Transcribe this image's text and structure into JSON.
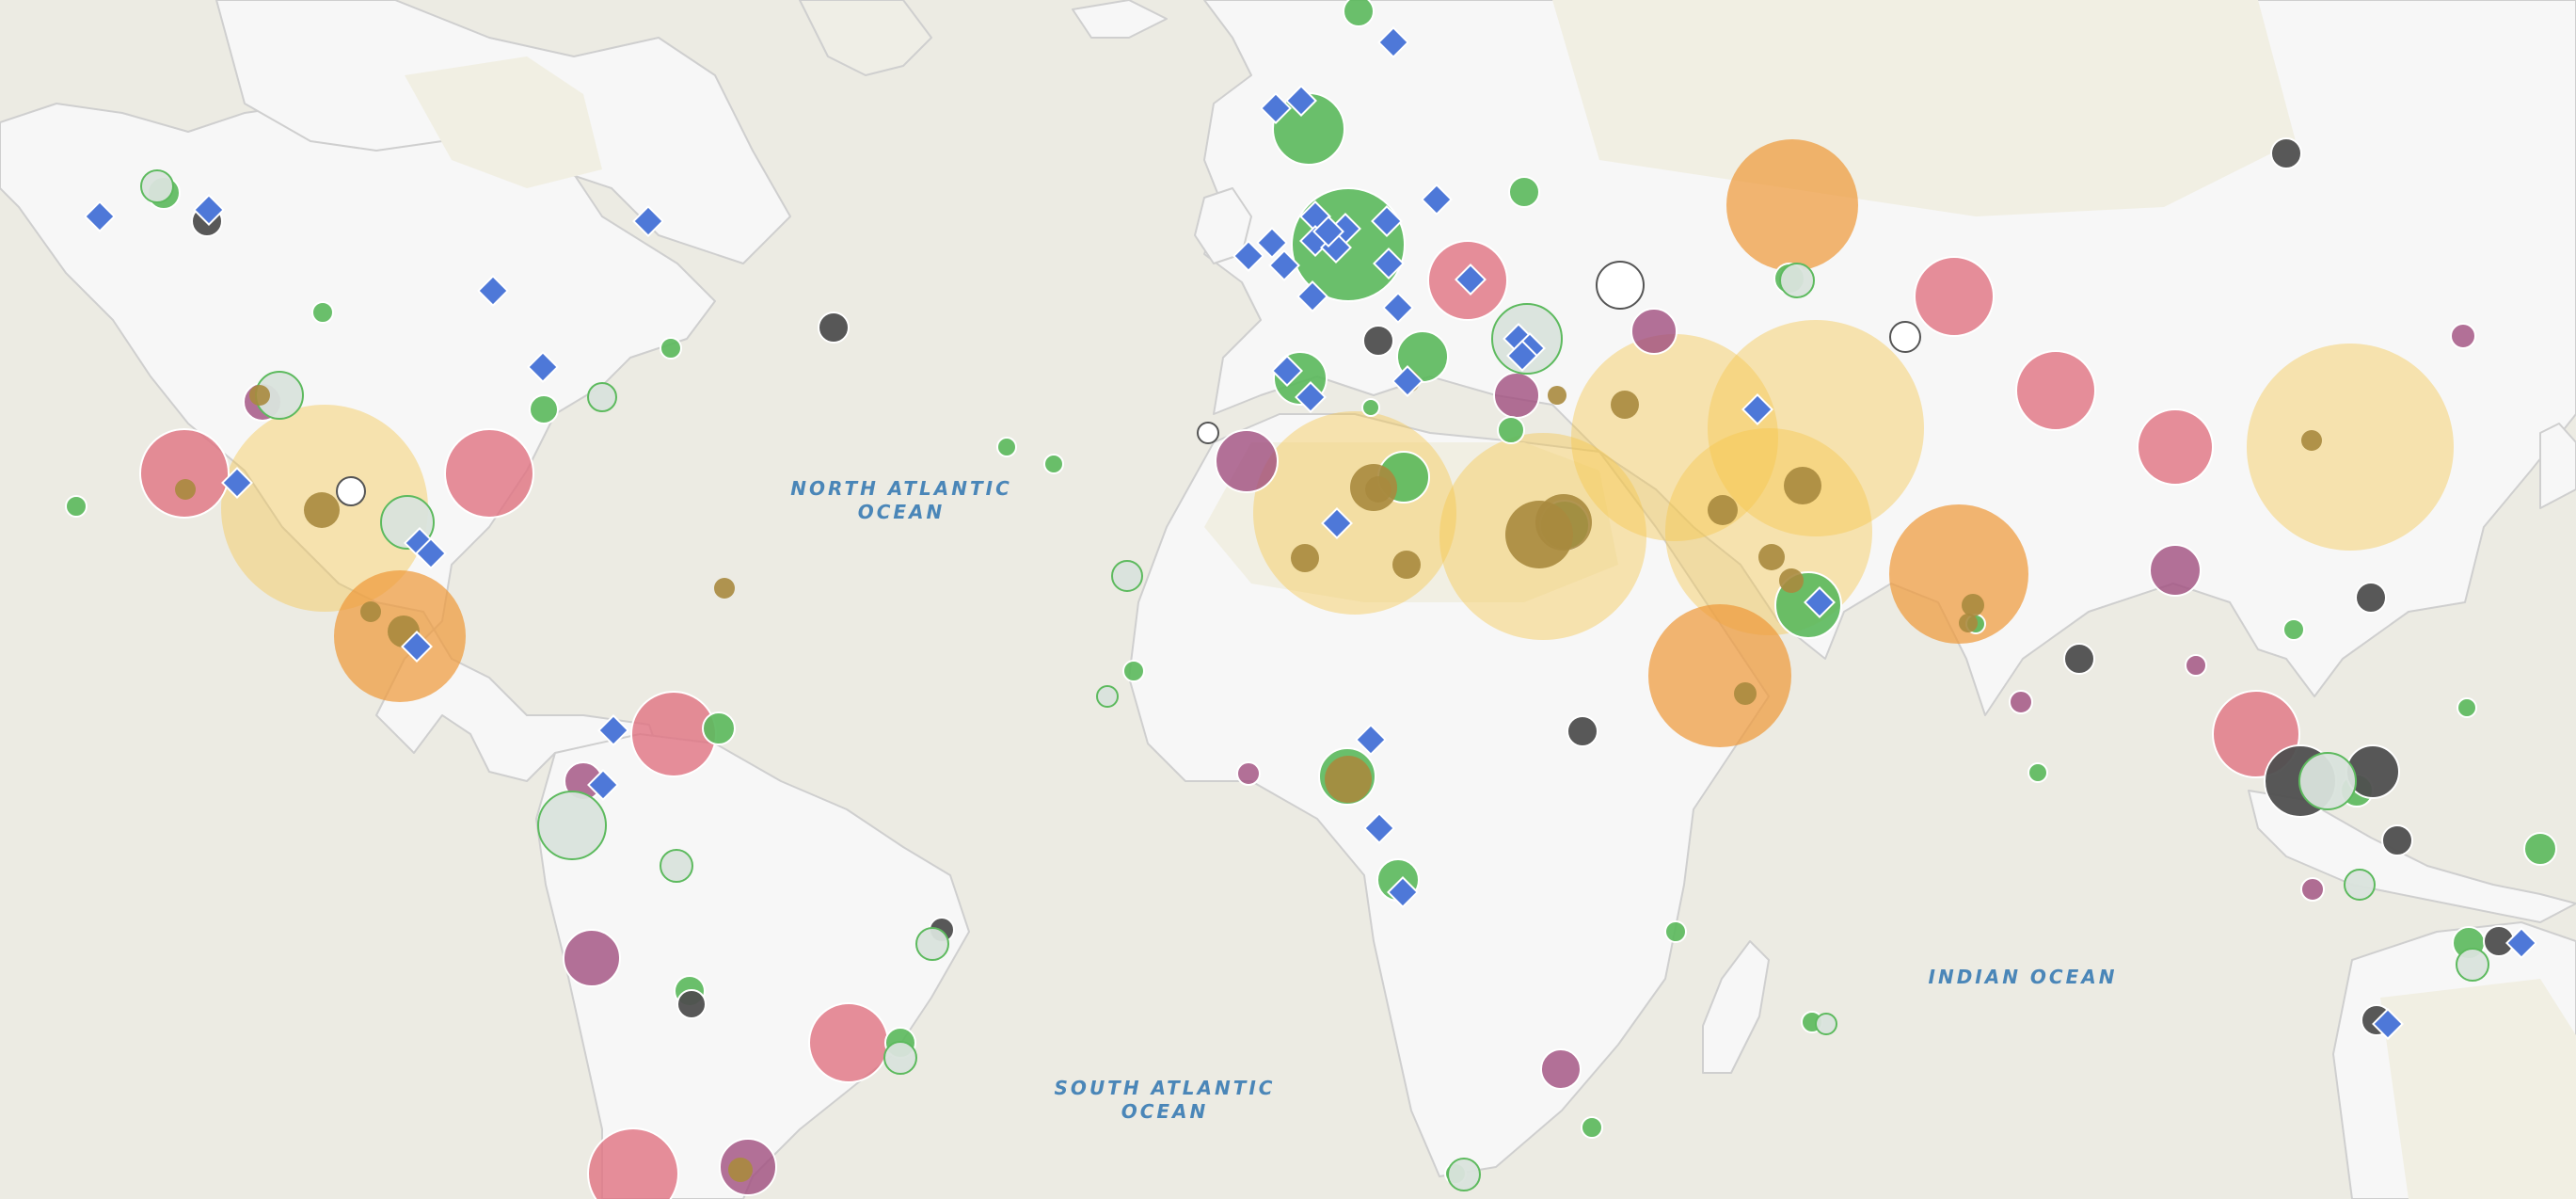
{
  "map": {
    "ocean_labels": {
      "north_atlantic": "NORTH ATLANTIC\nOCEAN",
      "south_atlantic": "SOUTH ATLANTIC\nOCEAN",
      "indian": "INDIAN OCEAN"
    },
    "colors": {
      "sea": "#ECEBE3",
      "land": "#F7F7F7",
      "land_border": "#CFCFCF",
      "dry_region": "#F4F2E6",
      "label": "#4A86B8",
      "marker_green": "#5DBA5E",
      "marker_grey": "#4F4F4F",
      "marker_pink": "#E0707F",
      "marker_purple": "#A04E7E",
      "marker_yellow": "#F5C54A",
      "marker_orange": "#EF9A3C",
      "marker_olive": "#A88A3E",
      "marker_blue_diamond": "#4E78D8",
      "marker_pale": "#D9E3DC"
    },
    "marker_types": [
      "green-circle",
      "grey-circle",
      "pink-circle",
      "purple-circle",
      "yellow-halo",
      "orange-halo",
      "olive-dot",
      "pale-circle",
      "blue-diamond",
      "white-circle"
    ]
  }
}
